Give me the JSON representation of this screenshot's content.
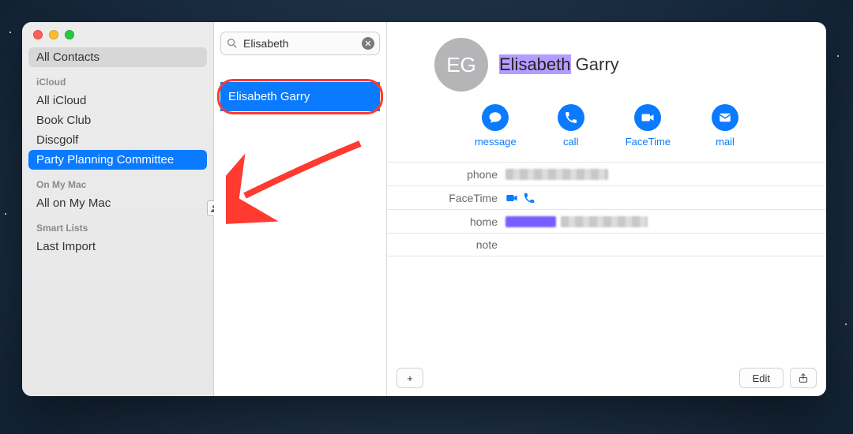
{
  "sidebar": {
    "top_item": "All Contacts",
    "groups": [
      {
        "title": "iCloud",
        "items": [
          "All iCloud",
          "Book Club",
          "Discgolf",
          "Party Planning Committee"
        ],
        "selected_index": 3
      },
      {
        "title": "On My Mac",
        "items": [
          "All on My Mac"
        ]
      },
      {
        "title": "Smart Lists",
        "items": [
          "Last Import"
        ]
      }
    ]
  },
  "search": {
    "value": "Elisabeth",
    "clear_icon": "clear-icon"
  },
  "results": [
    {
      "name": "Elisabeth Garry",
      "selected": true
    }
  ],
  "card": {
    "initials": "EG",
    "first_name": "Elisabeth",
    "last_name": "Garry",
    "actions": [
      {
        "key": "message",
        "label": "message"
      },
      {
        "key": "call",
        "label": "call"
      },
      {
        "key": "facetime",
        "label": "FaceTime"
      },
      {
        "key": "mail",
        "label": "mail"
      }
    ],
    "fields": [
      {
        "label": "phone"
      },
      {
        "label": "FaceTime"
      },
      {
        "label": "home"
      },
      {
        "label": "note"
      }
    ]
  },
  "footer": {
    "add": "+",
    "edit": "Edit"
  },
  "drag": {
    "at": "@"
  }
}
